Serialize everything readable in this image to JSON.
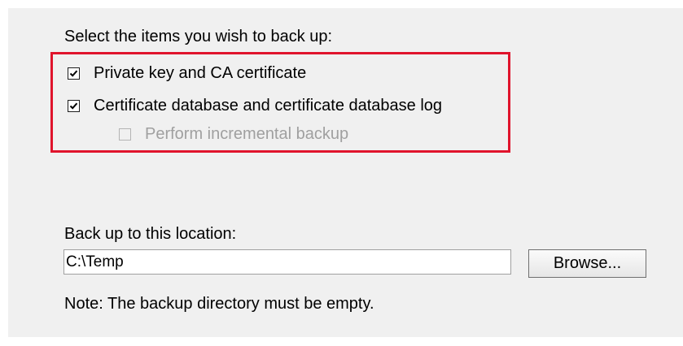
{
  "backup_items": {
    "heading": "Select the items you wish to back up:",
    "private_key": {
      "label": "Private key and CA certificate",
      "checked": true
    },
    "certificate_database": {
      "label": "Certificate database and certificate database log",
      "checked": true
    },
    "incremental": {
      "label": "Perform incremental backup",
      "checked": false,
      "enabled": false
    }
  },
  "location": {
    "label": "Back up to this location:",
    "path_value": "C:\\Temp",
    "browse_label": "Browse...",
    "note": "Note: The backup directory must be empty."
  },
  "colors": {
    "panel_background": "#f0f0f0",
    "highlight_border": "#e0142c",
    "disabled_text": "#a0a0a0"
  }
}
